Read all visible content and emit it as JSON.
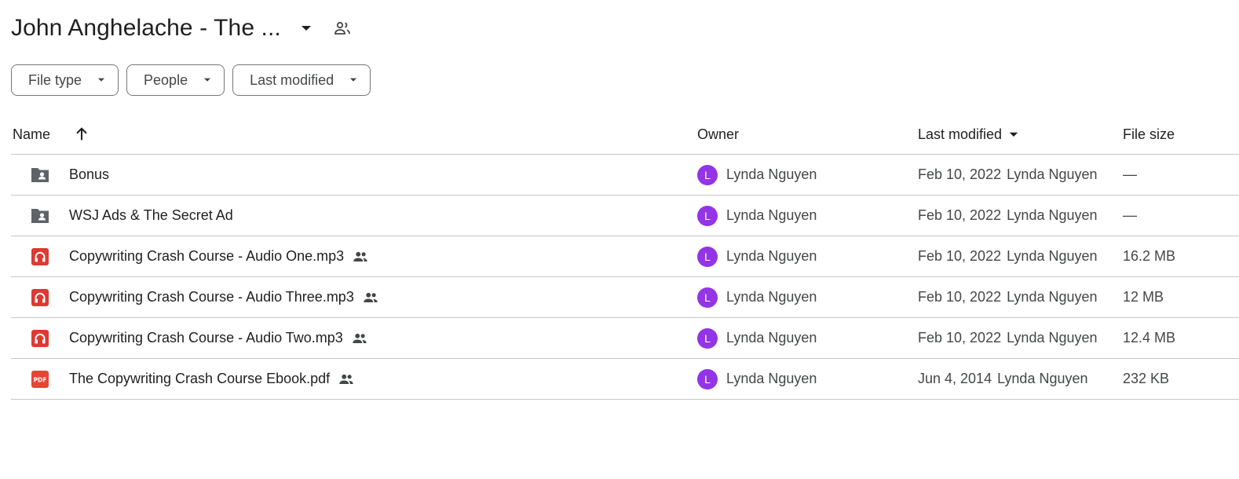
{
  "title": "John Anghelache - The ...",
  "icons": {
    "caret": "arrow-drop-down-icon",
    "share": "shared-with-people-icon",
    "sort": "arrow-up-icon",
    "folder": "shared-folder-icon",
    "audio": "audio-file-icon",
    "pdf": "pdf-file-icon"
  },
  "colors": {
    "avatar": "#9334e6",
    "audio_icon": "#dc3a31",
    "pdf_icon": "#ea4335",
    "folder_icon": "#5f6368"
  },
  "filters": [
    {
      "label": "File type"
    },
    {
      "label": "People"
    },
    {
      "label": "Last modified"
    }
  ],
  "columns": {
    "name": "Name",
    "owner": "Owner",
    "last_modified": "Last modified",
    "file_size": "File size"
  },
  "files": [
    {
      "type": "folder",
      "name": "Bonus",
      "shared": false,
      "owner_initial": "L",
      "owner": "Lynda Nguyen",
      "modified_date": "Feb 10, 2022",
      "modified_by": "Lynda Nguyen",
      "size": "—"
    },
    {
      "type": "folder",
      "name": "WSJ Ads & The Secret Ad",
      "shared": false,
      "owner_initial": "L",
      "owner": "Lynda Nguyen",
      "modified_date": "Feb 10, 2022",
      "modified_by": "Lynda Nguyen",
      "size": "—"
    },
    {
      "type": "audio",
      "name": "Copywriting Crash Course - Audio One.mp3",
      "shared": true,
      "owner_initial": "L",
      "owner": "Lynda Nguyen",
      "modified_date": "Feb 10, 2022",
      "modified_by": "Lynda Nguyen",
      "size": "16.2 MB"
    },
    {
      "type": "audio",
      "name": "Copywriting Crash Course - Audio Three.mp3",
      "shared": true,
      "owner_initial": "L",
      "owner": "Lynda Nguyen",
      "modified_date": "Feb 10, 2022",
      "modified_by": "Lynda Nguyen",
      "size": "12 MB"
    },
    {
      "type": "audio",
      "name": "Copywriting Crash Course - Audio Two.mp3",
      "shared": true,
      "owner_initial": "L",
      "owner": "Lynda Nguyen",
      "modified_date": "Feb 10, 2022",
      "modified_by": "Lynda Nguyen",
      "size": "12.4 MB"
    },
    {
      "type": "pdf",
      "name": "The Copywriting Crash Course Ebook.pdf",
      "shared": true,
      "owner_initial": "L",
      "owner": "Lynda Nguyen",
      "modified_date": "Jun 4, 2014",
      "modified_by": "Lynda Nguyen",
      "size": "232 KB"
    }
  ]
}
